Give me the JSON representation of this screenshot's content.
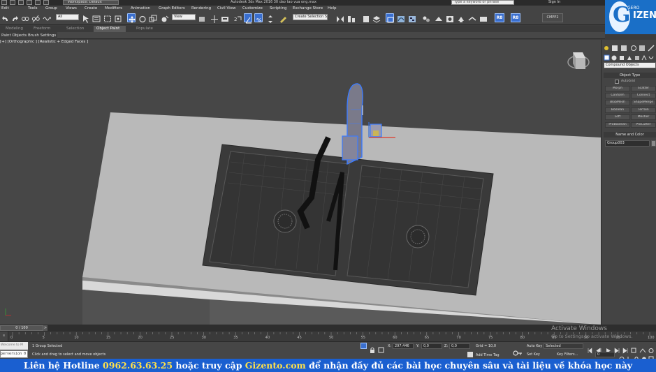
{
  "titlebar": {
    "workspace": "Workspace: Default",
    "app_title": "Autodesk 3ds Max 2016    30 dao tao vua ong.max",
    "search_placeholder": "Type a keyword or phrase",
    "signin": "Sign In"
  },
  "menu": [
    "Edit",
    "Tools",
    "Group",
    "Views",
    "Create",
    "Modifiers",
    "Animation",
    "Graph Editors",
    "Rendering",
    "Civil View",
    "Customize",
    "Scripting",
    "Exchange Store",
    "Help"
  ],
  "toolbar": {
    "filter_all": "All",
    "ref_coord": "View",
    "selection_set": "Create Selection Se",
    "badge_1": "R8",
    "badge_2": "R8",
    "cmpp": "CMPP2"
  },
  "logo": {
    "small": "GERO",
    "text": "IZEN"
  },
  "ribbon": {
    "tabs": [
      "Modeling",
      "Freeform",
      "Selection",
      "Object Paint",
      "Populate"
    ],
    "active_tab": "Object Paint",
    "row2": [
      "Paint Objects",
      "Brush Settings"
    ]
  },
  "viewport": {
    "label": "[+] [Orthographic ] [Realistic + Edged Faces ]"
  },
  "command_panel": {
    "category": "Compound Objects",
    "object_type_header": "Object Type",
    "autogrid": "AutoGrid",
    "buttons": [
      "Morph",
      "Scatter",
      "Conform",
      "Connect",
      "BlobMesh",
      "ShapeMerge",
      "Boolean",
      "Terrain",
      "Loft",
      "Mesher",
      "ProBoolean",
      "ProCutter"
    ],
    "name_color_header": "Name and Color",
    "object_name": "Group003"
  },
  "timeline": {
    "frame": "0 / 100",
    "ticks": [
      "0",
      "5",
      "10",
      "15",
      "20",
      "25",
      "30",
      "35",
      "40",
      "45",
      "50",
      "55",
      "60",
      "65",
      "70",
      "75",
      "80",
      "85",
      "90",
      "95",
      "100"
    ]
  },
  "status": {
    "left_label": "Welcome to M",
    "maxscript": "perversion 0",
    "selected": "1 Group Selected",
    "prompt": "Click and drag to select and move objects",
    "x_label": "X:",
    "x_value": "297,446",
    "y_label": "Y:",
    "y_value": "0,0",
    "z_label": "Z:",
    "z_value": "0,0",
    "grid": "Grid = 10,0",
    "add_time_tag": "Add Time Tag",
    "auto_key": "Auto Key",
    "set_key": "Set Key",
    "selected_dd": "Selected",
    "key_filters": "Key Filters...",
    "frame_field": "0"
  },
  "watermark": {
    "title": "Activate Windows",
    "sub": "Go to Settings to activate Windows."
  },
  "banner": {
    "part1": "Liên hệ Hotline ",
    "hotline": "0962.63.63.25",
    "part2": " hoặc truy cập ",
    "site": "Gizento.com",
    "part3": " để nhận đầy đủ các bài học chuyên sâu và tài liệu về khóa học này"
  },
  "colors": {
    "banner_bg": "#1a5fd0",
    "banner_highlight": "#ffe14a",
    "selection_blue": "#3b7bff",
    "viewport_bg": "#474747"
  }
}
